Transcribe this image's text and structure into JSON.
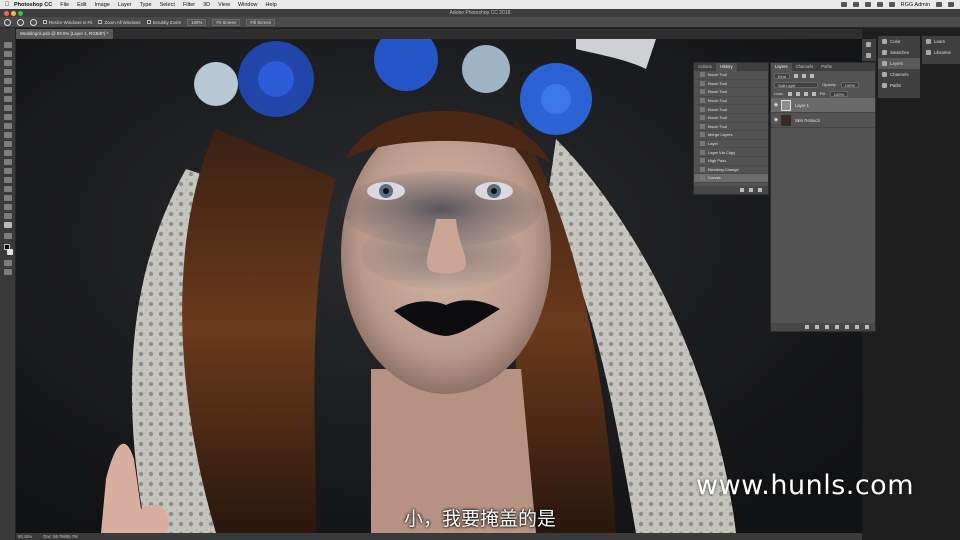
{
  "menubar": {
    "app_name": "Photoshop CC",
    "items": [
      "File",
      "Edit",
      "Image",
      "Layer",
      "Type",
      "Select",
      "Filter",
      "3D",
      "View",
      "Window",
      "Help"
    ],
    "user": "RGG Admin"
  },
  "window": {
    "title": "Adobe Photoshop CC 2018"
  },
  "options_bar": {
    "resize_windows": "Resize Windows to Fit",
    "zoom_all": "Zoom All Windows",
    "scrubby_zoom": "Scrubby Zoom",
    "zoom_100": "100%",
    "fit_screen": "Fit Screen",
    "fill_screen": "Fill Screen"
  },
  "document": {
    "tab_label": "Weddingck.psb @ 93.5% (Layer 1, RGB/8*) *",
    "zoom_status": "93.15%",
    "doc_status": "Doc: 58.7M/99.7M"
  },
  "history_panel": {
    "tabs": [
      "Actions",
      "History"
    ],
    "items": [
      "Brush Tool",
      "Brush Tool",
      "Brush Tool",
      "Brush Tool",
      "Brush Tool",
      "Brush Tool",
      "Brush Tool",
      "Merge Layers",
      "Layer",
      "Layer Via Copy",
      "High Pass",
      "Blending Change",
      "Curves"
    ],
    "selected_index": 12
  },
  "layers_panel": {
    "tabs": [
      "Layers",
      "Channels",
      "Paths"
    ],
    "kind_filter": "Kind",
    "blend_mode": "Soft Light",
    "opacity_label": "Opacity:",
    "opacity_value": "100%",
    "lock_label": "Lock:",
    "fill_label": "Fill:",
    "fill_value": "100%",
    "layers": [
      {
        "name": "Layer 1",
        "selected": true
      },
      {
        "name": "Skin Retouch",
        "selected": false
      }
    ]
  },
  "dock_mid": [
    "Color",
    "Swatches",
    "Layers",
    "Channels",
    "Paths"
  ],
  "dock_right": [
    "Learn",
    "Libraries"
  ],
  "overlays": {
    "watermark": "www.hunls.com",
    "subtitle": "小，我要掩盖的是"
  },
  "icons": {
    "traffic_close": "#fe5f57",
    "traffic_min": "#febc2e",
    "traffic_max": "#28c840"
  }
}
